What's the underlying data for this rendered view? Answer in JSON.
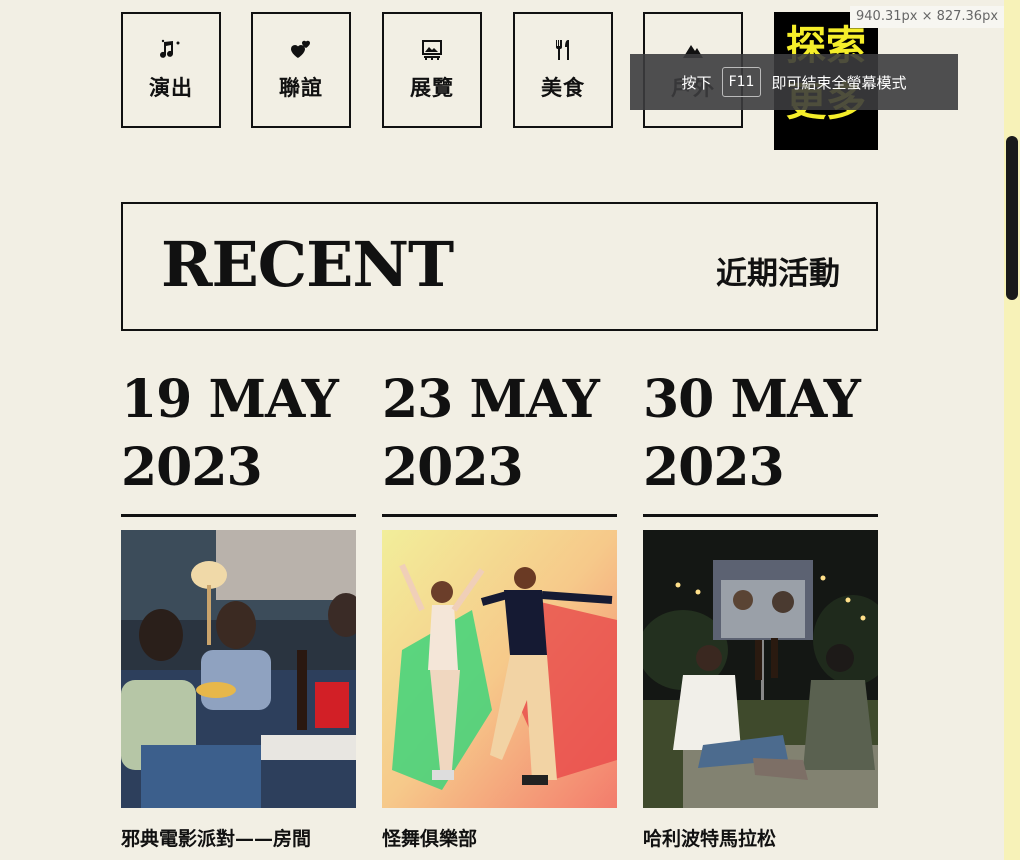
{
  "categories": [
    {
      "label": "演出",
      "icon": "music-notes-icon"
    },
    {
      "label": "聯誼",
      "icon": "hearts-icon"
    },
    {
      "label": "展覽",
      "icon": "gallery-icon"
    },
    {
      "label": "美食",
      "icon": "utensils-icon"
    },
    {
      "label": "戶外",
      "icon": "mountain-icon"
    }
  ],
  "explore": {
    "line1": "探索",
    "line2": "更多",
    "color": "#f5ee2a"
  },
  "size_badge": "940.31px × 827.36px",
  "fullscreen_toast": {
    "prefix": "按下",
    "key": "F11",
    "suffix": "即可結束全螢幕模式"
  },
  "recent": {
    "title_en": "RECENT",
    "title_zh": "近期活動"
  },
  "events": [
    {
      "date": "19 MAY\n2023",
      "title": "邪典電影派對——房間"
    },
    {
      "date": "23 MAY\n2023",
      "title": "怪舞俱樂部"
    },
    {
      "date": "30 MAY\n2023",
      "title": "哈利波特馬拉松"
    }
  ]
}
